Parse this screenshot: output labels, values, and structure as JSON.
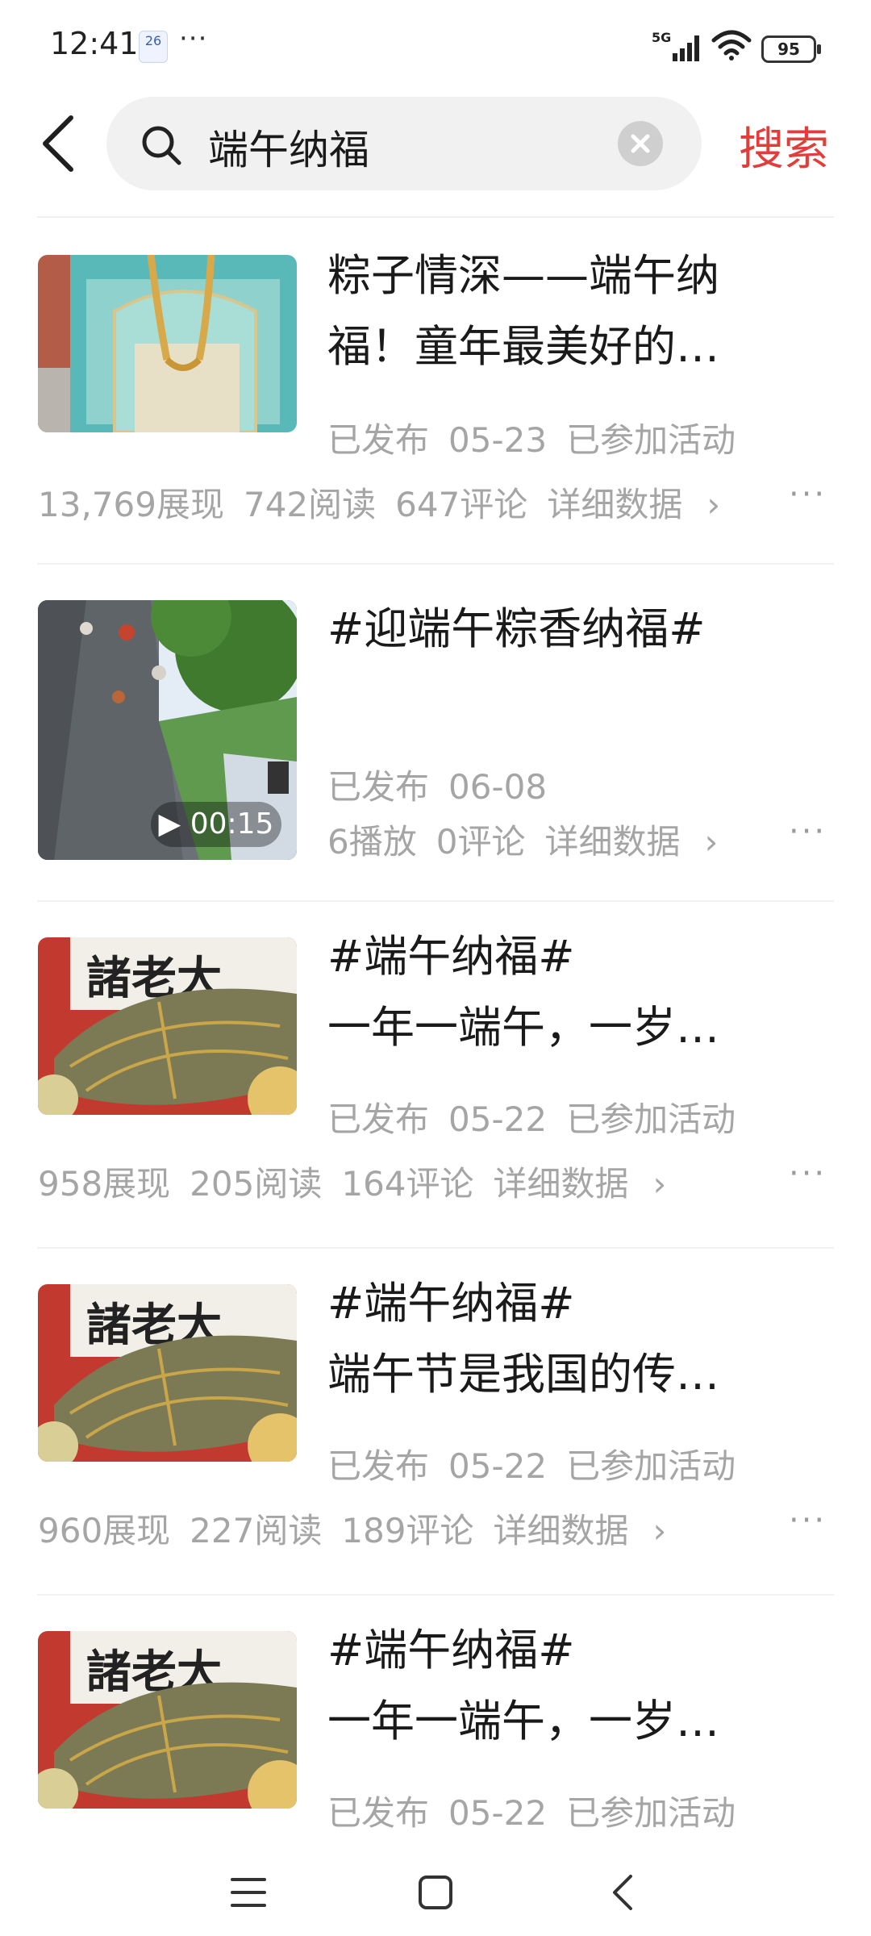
{
  "status_bar": {
    "time": "12:41",
    "calendar_day": "26",
    "dots": "···",
    "network": "5G",
    "battery": "95"
  },
  "search": {
    "query": "端午纳福",
    "button": "搜索"
  },
  "items": [
    {
      "title_lines": [
        "粽子情深——端午纳",
        "福！童年最美好的…"
      ],
      "status": "已发布",
      "date": "05-23",
      "activity": "已参加活动",
      "stats": [
        "13,769展现",
        "742阅读",
        "647评论"
      ],
      "detail": "详细数据"
    },
    {
      "title_lines": [
        "#迎端午粽香纳福#"
      ],
      "status": "已发布",
      "date": "06-08",
      "activity": "",
      "stats": [
        "6播放",
        "0评论"
      ],
      "detail": "详细数据",
      "duration": "00:15"
    },
    {
      "title_lines": [
        "#端午纳福#",
        "一年一端午，一岁…"
      ],
      "status": "已发布",
      "date": "05-22",
      "activity": "已参加活动",
      "stats": [
        "958展现",
        "205阅读",
        "164评论"
      ],
      "detail": "详细数据",
      "thumb_text": "諸老大"
    },
    {
      "title_lines": [
        "#端午纳福#",
        "端午节是我国的传…"
      ],
      "status": "已发布",
      "date": "05-22",
      "activity": "已参加活动",
      "stats": [
        "960展现",
        "227阅读",
        "189评论"
      ],
      "detail": "详细数据",
      "thumb_text": "諸老大"
    },
    {
      "title_lines": [
        "#端午纳福#",
        "一年一端午，一岁…"
      ],
      "status": "已发布",
      "date": "05-22",
      "activity": "已参加活动",
      "thumb_text": "諸老大"
    }
  ],
  "more_label": "···",
  "colors": {
    "accent": "#e23d3a",
    "muted": "#a5a5a5"
  },
  "nav": [
    "menu-icon",
    "home-square-icon",
    "back-icon"
  ]
}
